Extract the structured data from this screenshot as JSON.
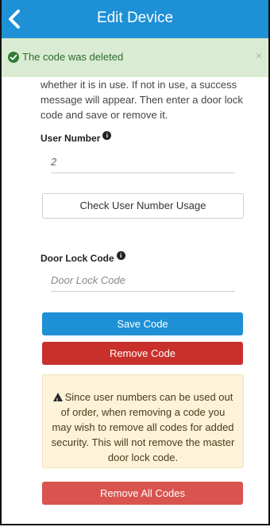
{
  "header": {
    "title": "Edit Device"
  },
  "alert": {
    "message": "The code was deleted",
    "close_glyph": "×"
  },
  "intro": {
    "text": "whether it is in use. If not in use, a success message will appear. Then enter a door lock code and save or remove it."
  },
  "user_number": {
    "label": "User Number",
    "value": "2",
    "info_glyph": "i"
  },
  "check_usage_button": {
    "label": "Check User Number Usage"
  },
  "door_lock_code": {
    "label": "Door Lock Code",
    "placeholder": "Door Lock Code",
    "info_glyph": "i"
  },
  "save_button": {
    "label": "Save Code"
  },
  "remove_button": {
    "label": "Remove Code"
  },
  "warning": {
    "text": "Since user numbers can be used out of order, when removing a code you may wish to remove all codes for added security. This will not remove the master door lock code."
  },
  "remove_all_button": {
    "label": "Remove All Codes"
  },
  "colors": {
    "header": "#1e90d6",
    "success_bg": "#d9ecd3",
    "danger": "#c9302c",
    "warning_bg": "#fcf3d9"
  }
}
